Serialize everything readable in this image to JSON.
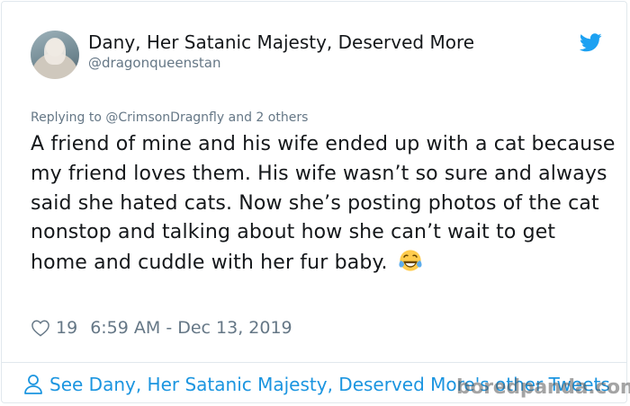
{
  "tweet": {
    "author": {
      "display_name": "Dany, Her Satanic Majesty, Deserved More",
      "handle": "@dragonqueenstan"
    },
    "replying_prefix": "Replying to",
    "replying_mention": "@CrimsonDragnfly",
    "replying_suffix": "and 2 others",
    "text": "A friend of mine and his wife ended up with a cat because my friend loves them. His wife wasn’t so sure and always said she hated cats. Now she’s posting photos of the cat nonstop and talking about how she can’t wait to get home and cuddle with her fur baby.",
    "emoji": "face-with-tears-of-joy",
    "like_count": "19",
    "timestamp": "6:59 AM - Dec 13, 2019",
    "see_more_label": "See Dany, Her Satanic Majesty, Deserved More's other Tweets"
  },
  "watermark": "boredpanda.com",
  "colors": {
    "twitter_blue": "#1da1f2",
    "link_blue": "#1b95e0",
    "secondary_text": "#657786",
    "primary_text": "#14171a",
    "border": "#e1e8ed"
  },
  "icons": {
    "brand": "twitter-bird-icon",
    "like": "heart-outline-icon",
    "profile": "person-outline-icon"
  }
}
